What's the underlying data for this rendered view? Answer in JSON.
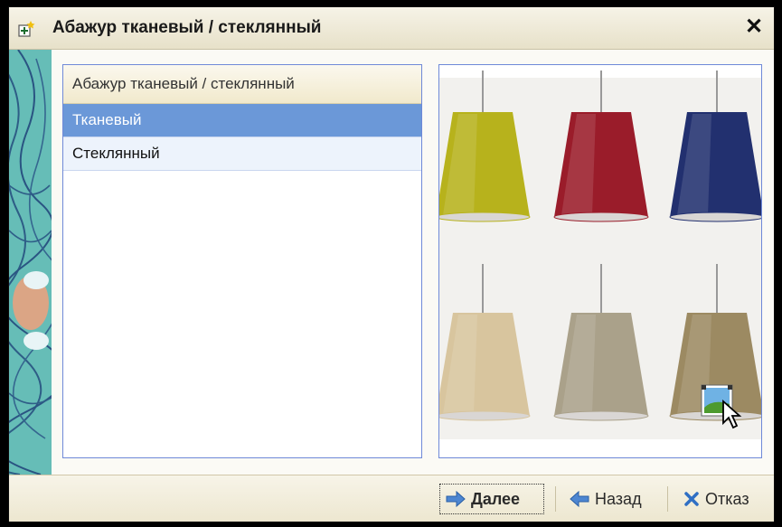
{
  "window": {
    "title": "Абажур тканевый / стеклянный"
  },
  "list": {
    "header": "Абажур тканевый / стеклянный",
    "items": [
      {
        "label": "Тканевый",
        "selected": true
      },
      {
        "label": "Стеклянный",
        "selected": false
      }
    ]
  },
  "lamps": [
    {
      "color": "#b7b21c"
    },
    {
      "color": "#9a1c2a"
    },
    {
      "color": "#22306f"
    },
    {
      "color": "#d8c59e"
    },
    {
      "color": "#aaa18a"
    },
    {
      "color": "#9c8a62"
    }
  ],
  "buttons": {
    "next": "Далее",
    "back": "Назад",
    "cancel": "Отказ"
  },
  "icons": {
    "title": "window-add-icon",
    "close": "close-icon",
    "next": "arrow-right-icon",
    "back": "arrow-left-icon",
    "cancel": "x-icon",
    "image_tool": "picture-icon",
    "cursor": "mouse-cursor-icon"
  },
  "colors": {
    "selection": "#6b98d8",
    "panel_border": "#6f89d8",
    "accent_blue": "#3c6fb9"
  }
}
